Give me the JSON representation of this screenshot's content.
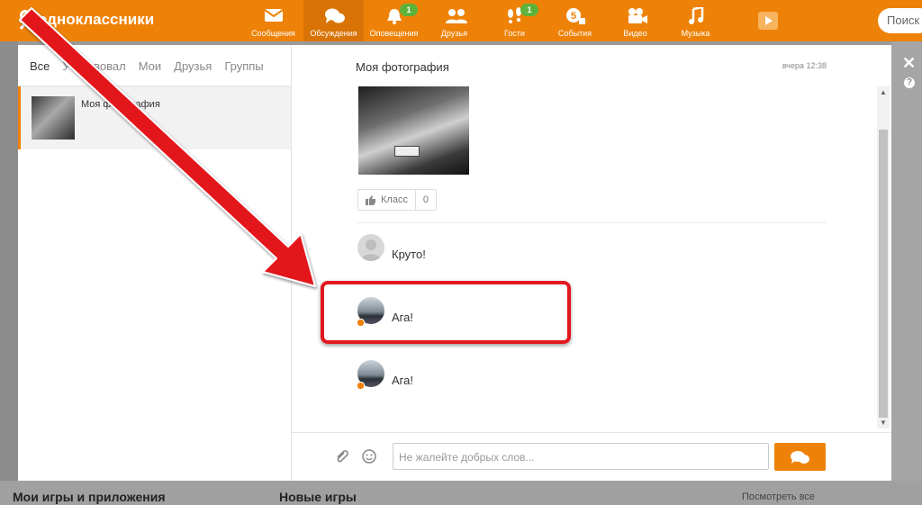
{
  "header": {
    "logo_text": "одноклассники",
    "search_placeholder": "Поиск",
    "nav": [
      {
        "label": "Сообщения",
        "icon": "envelope-icon",
        "badge": ""
      },
      {
        "label": "Обсуждения",
        "icon": "chat-bubbles-icon",
        "badge": "",
        "active": true
      },
      {
        "label": "Оповещения",
        "icon": "bell-icon",
        "badge": "1"
      },
      {
        "label": "Друзья",
        "icon": "friends-icon",
        "badge": ""
      },
      {
        "label": "Гости",
        "icon": "footprints-icon",
        "badge": "1"
      },
      {
        "label": "События",
        "icon": "events-icon",
        "badge": ""
      },
      {
        "label": "Видео",
        "icon": "video-camera-icon",
        "badge": ""
      },
      {
        "label": "Музыка",
        "icon": "music-note-icon",
        "badge": ""
      }
    ],
    "events_counter": "5"
  },
  "left_panel": {
    "tabs": [
      "Все",
      "Участвовал",
      "Мои",
      "Друзья",
      "Группы"
    ],
    "active_tab": "Все",
    "conversations": [
      {
        "title": "Моя фотография"
      }
    ]
  },
  "discussion": {
    "title": "Моя фотография",
    "time": "вчера 12:38",
    "klass_label": "Класс",
    "klass_count": "0",
    "comments": [
      {
        "text": "Круто!",
        "avatar": "default-female"
      },
      {
        "text": "Ага!",
        "avatar": "car-photo"
      },
      {
        "text": "Ага!",
        "avatar": "car-photo"
      }
    ],
    "input_placeholder": "Не жалейте добрых слов..."
  },
  "background": {
    "bottom_left_title": "Мои игры и приложения",
    "bottom_mid_title": "Новые игры",
    "bottom_right_link": "Посмотреть все"
  },
  "colors": {
    "brand_orange": "#ee8208",
    "annotation_red": "#e3171f",
    "badge_green": "#5db33a"
  }
}
